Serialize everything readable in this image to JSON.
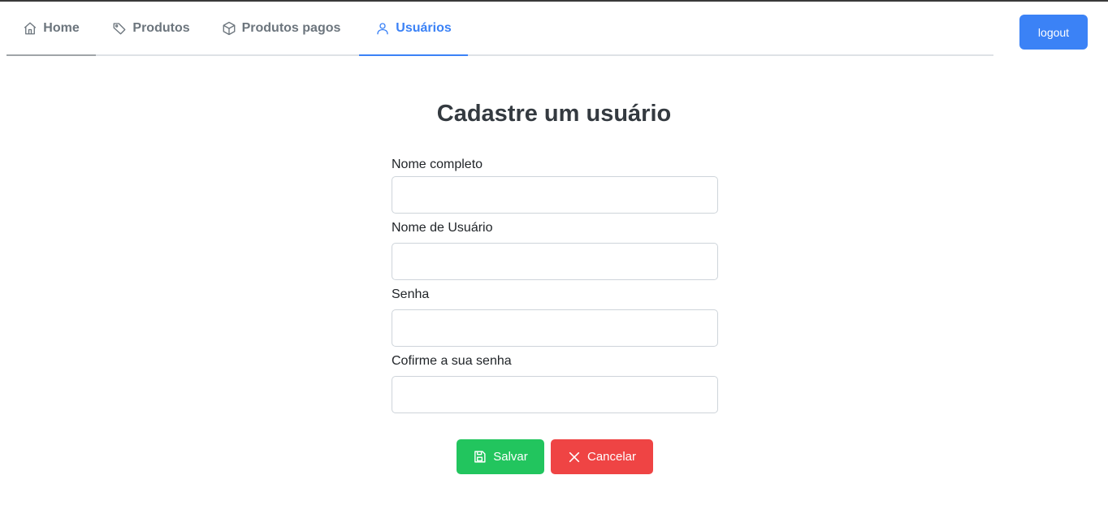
{
  "nav": {
    "tabs": [
      {
        "label": "Home",
        "icon": "home-icon"
      },
      {
        "label": "Produtos",
        "icon": "tag-icon"
      },
      {
        "label": "Produtos pagos",
        "icon": "box-icon"
      },
      {
        "label": "Usuários",
        "icon": "user-icon",
        "active": true
      }
    ],
    "logout_label": "logout"
  },
  "form": {
    "title": "Cadastre um usuário",
    "fields": [
      {
        "label": "Nome completo",
        "value": ""
      },
      {
        "label": "Nome de Usuário",
        "value": ""
      },
      {
        "label": "Senha",
        "value": ""
      },
      {
        "label": "Cofirme a sua senha",
        "value": ""
      }
    ],
    "save_label": "Salvar",
    "cancel_label": "Cancelar"
  },
  "colors": {
    "accent": "#3b82f6",
    "save": "#22c55e",
    "cancel": "#ef4444"
  }
}
